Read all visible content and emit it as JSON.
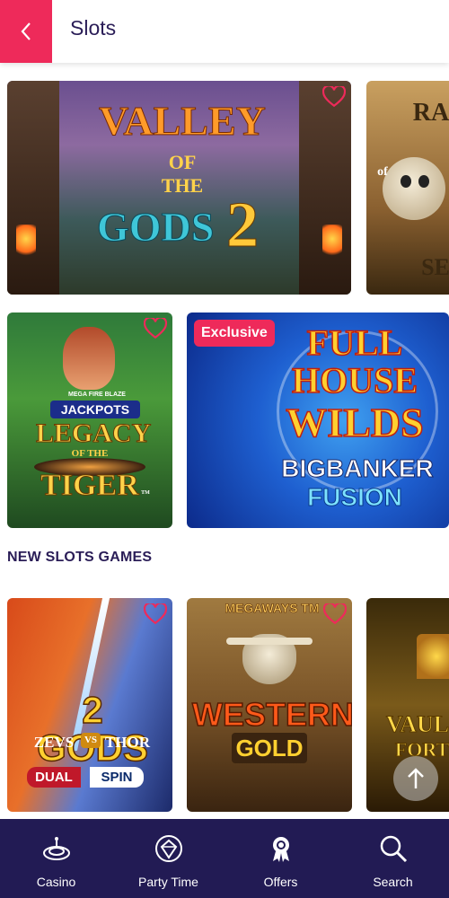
{
  "header": {
    "title": "Slots",
    "back_icon": "chevron-left-icon"
  },
  "colors": {
    "accent": "#ee2a5a",
    "nav_bg": "#221b54",
    "title": "#2a1d57"
  },
  "featured": [
    {
      "title_line1": "VALLEY",
      "title_line2": "OF",
      "title_line3": "THE",
      "title_line4": "GODS",
      "title_num": "2"
    },
    {
      "title_line1": "RA",
      "title_line2": "of",
      "title_line3": "SE"
    }
  ],
  "row2": [
    {
      "jackpot": "JACKPOTS",
      "jackpot_top": "MEGA FIRE BLAZE",
      "title_line1": "LEGACY",
      "title_line2": "OF THE",
      "title_line3": "TIGER",
      "tm": "TM"
    },
    {
      "badge": "Exclusive",
      "title_line1": "FULL",
      "title_line2": "HOUSE",
      "title_line3": "WILDS",
      "title_line4": "BIGBANKER",
      "title_line5": "FUSION"
    }
  ],
  "section": {
    "title": "NEW SLOTS GAMES"
  },
  "new_games": [
    {
      "title_line1": "2 GODS",
      "title_line2": "ZEVS",
      "vs": "VS",
      "title_line3": "THOR",
      "title_line4": "DUAL",
      "title_line5": "SPIN"
    },
    {
      "top": "MEGAWAYS TM",
      "title_line1": "WESTERN",
      "title_line2": "GOLD"
    },
    {
      "title_line1": "VAUL",
      "title_line2": "FORT"
    }
  ],
  "nav": [
    {
      "label": "Casino",
      "icon": "roulette-icon"
    },
    {
      "label": "Party Time",
      "icon": "diamond-badge-icon"
    },
    {
      "label": "Offers",
      "icon": "rosette-icon"
    },
    {
      "label": "Search",
      "icon": "search-icon"
    }
  ]
}
